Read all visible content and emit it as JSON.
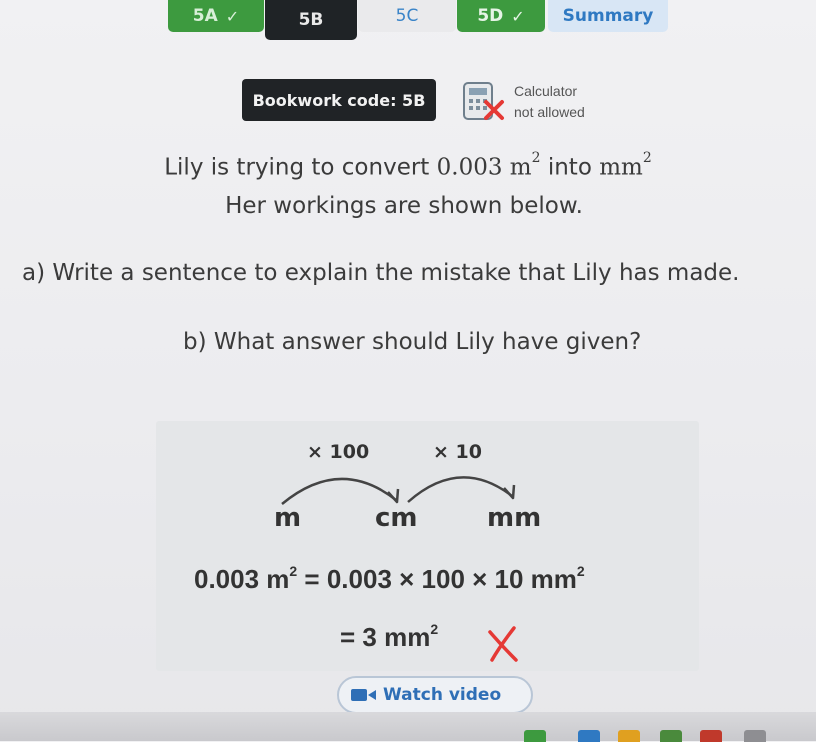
{
  "tabs": [
    {
      "label": "5A",
      "check": "✓"
    },
    {
      "label": "5B"
    },
    {
      "label": "5C"
    },
    {
      "label": "5D",
      "check": "✓"
    },
    {
      "label": "Summary"
    }
  ],
  "bookwork": {
    "label": "Bookwork code: 5B"
  },
  "calculator": {
    "line1": "Calculator",
    "line2": "not allowed"
  },
  "prompt": {
    "line1_a": "Lily is trying to convert ",
    "value": "0.003",
    "unit_m": "m",
    "exp": "2",
    "line1_b": " into ",
    "unit_mm": "mm",
    "line2": "Her workings are shown below."
  },
  "questions": {
    "a": "a) Write a sentence to explain the mistake that Lily has made.",
    "b": "b) What answer should Lily have given?"
  },
  "workings": {
    "mult1": "× 100",
    "mult2": "× 10",
    "units": [
      "m",
      "cm",
      "mm"
    ],
    "eq_left": "0.003 m",
    "eq_right": " = 0.003 × 100 × 10 mm",
    "exp": "2",
    "result": "= 3 mm",
    "cross_color": "#e53935"
  },
  "watch_video": {
    "label": "Watch video"
  },
  "colors": {
    "green": "#3d9a3f",
    "dark": "#1f2326",
    "blue": "#2f79c2"
  }
}
